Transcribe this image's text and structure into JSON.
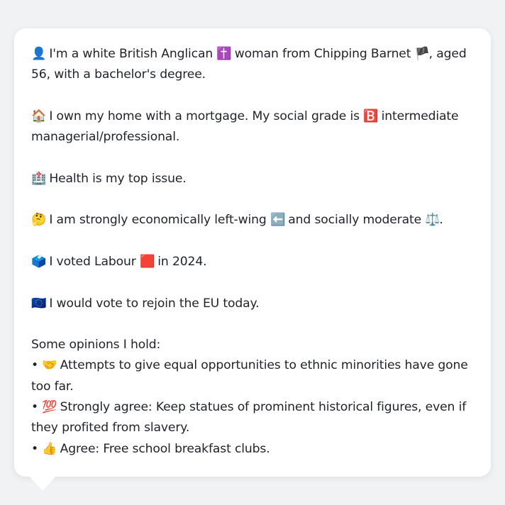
{
  "profile": {
    "identity": {
      "icon": "👤",
      "text_a": "I'm a white British Anglican",
      "icon2": "✝️",
      "text_b": "woman from Chipping Barnet",
      "icon3": "🏴",
      "text_c": ", aged 56, with a bachelor's degree."
    },
    "housing": {
      "icon": "🏠",
      "text_a": "I own my home with a mortgage. My social grade is",
      "icon2": "🅱️",
      "text_b": "intermediate managerial/professional."
    },
    "issue": {
      "icon": "🏥",
      "text": "Health is my top issue."
    },
    "politics": {
      "icon": "🤔",
      "text_a": "I am strongly economically left-wing",
      "icon2": "⬅️",
      "text_b": "and socially moderate",
      "icon3": "⚖️",
      "text_c": "."
    },
    "vote": {
      "icon": "🗳️",
      "text_a": "I voted Labour",
      "icon2": "🟥",
      "text_b": "in 2024."
    },
    "eu": {
      "icon": "🇪🇺",
      "text": "I would vote to rejoin the EU today."
    },
    "opinions": {
      "heading": "Some opinions I hold:",
      "items": [
        {
          "bullet": "•",
          "icon": "🤝",
          "text": "Attempts to give equal opportunities to ethnic minorities have gone too far."
        },
        {
          "bullet": "•",
          "icon": "💯",
          "text": "Strongly agree: Keep statues of prominent historical figures, even if they profited from slavery."
        },
        {
          "bullet": "•",
          "icon": "👍",
          "text": "Agree: Free school breakfast clubs."
        }
      ]
    }
  }
}
